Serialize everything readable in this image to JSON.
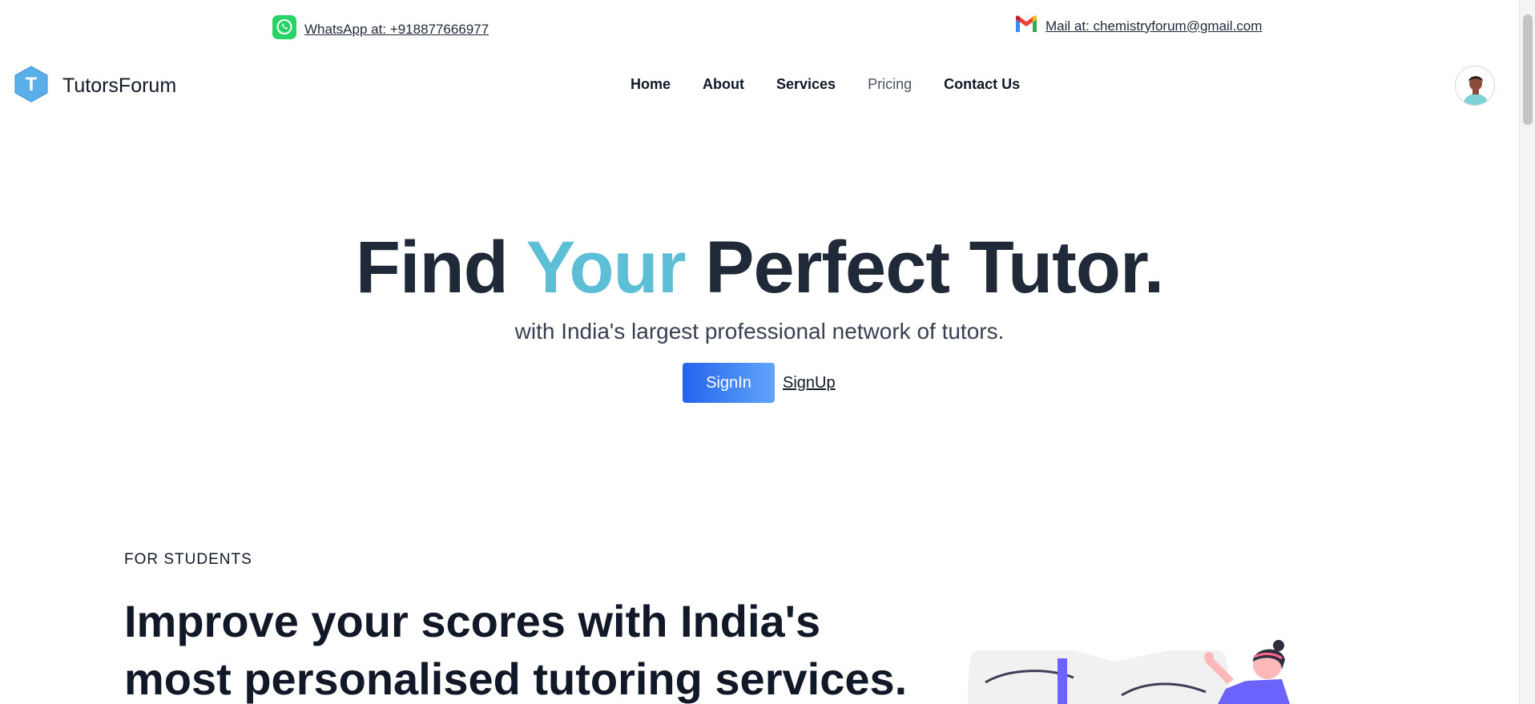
{
  "topbar": {
    "whatsapp_text": "WhatsApp at: +918877666977",
    "whatsapp_icon": "whatsapp-icon",
    "mail_text": "Mail at: chemistryforum@gmail.com",
    "mail_icon": "gmail-icon"
  },
  "navbar": {
    "logo_letter": "T",
    "brand": "TutorsForum",
    "items": [
      {
        "label": "Home"
      },
      {
        "label": "About"
      },
      {
        "label": "Services"
      },
      {
        "label": "Pricing"
      },
      {
        "label": "Contact Us"
      }
    ]
  },
  "hero": {
    "title_part1": "Find ",
    "title_accent": "Your",
    "title_part2": " Perfect Tutor.",
    "subtitle": "with India's largest professional network of tutors.",
    "signin_label": "SignIn",
    "signup_label": "SignUp"
  },
  "students": {
    "eyebrow": "FOR STUDENTS",
    "heading": "Improve your scores with India's most personalised tutoring services."
  },
  "colors": {
    "accent": "#5cbfd6",
    "button_start": "#2563eb",
    "button_end": "#60a5fa",
    "text": "#1f2937"
  }
}
